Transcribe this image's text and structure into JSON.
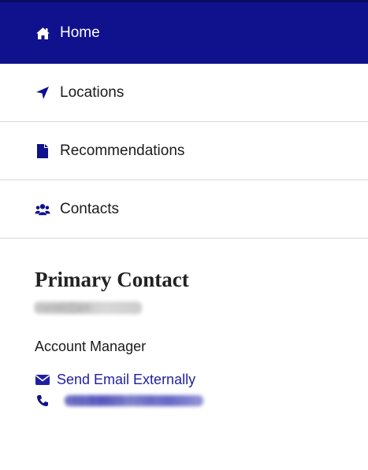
{
  "nav": {
    "items": [
      {
        "label": "Home",
        "icon": "home-icon",
        "active": true
      },
      {
        "label": "Locations",
        "icon": "location-arrow-icon",
        "active": false
      },
      {
        "label": "Recommendations",
        "icon": "document-icon",
        "active": false
      },
      {
        "label": "Contacts",
        "icon": "users-icon",
        "active": false
      }
    ]
  },
  "contact": {
    "title": "Primary Contact",
    "name": "Darren Cant",
    "role": "Account Manager",
    "email_label": "Send Email Externally",
    "phone": "+61 3 9623 7258"
  },
  "colors": {
    "nav_active_bg": "#10118c",
    "link": "#1f1fa3",
    "divider": "#d9d9d9"
  }
}
